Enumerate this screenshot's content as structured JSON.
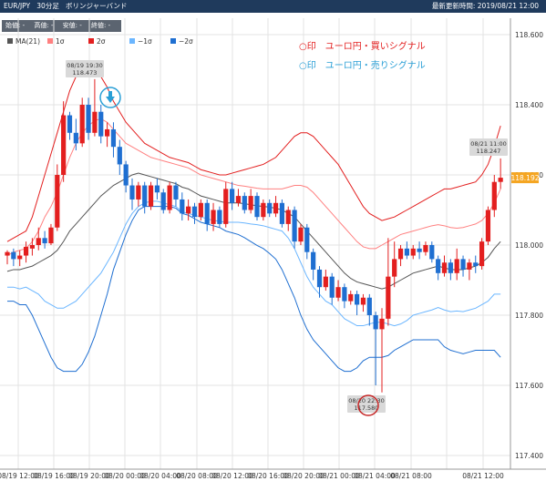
{
  "header": {
    "symbol": "EUR/JPY",
    "interval": "30分足",
    "indicator": "ボリンジャーバンド",
    "updated": "最新更新時間: 2019/08/21 12:00"
  },
  "ohlc": {
    "open": "始値: -",
    "high": "高値: -",
    "low": "安値: -",
    "close": "終値: -"
  },
  "legend": {
    "items": [
      {
        "label": "MA(21)",
        "color": "#555555"
      },
      {
        "label": "1σ",
        "color": "#ff8080"
      },
      {
        "label": "2σ",
        "color": "#e31f1f"
      },
      {
        "label": "−1σ",
        "color": "#6bb6ff"
      },
      {
        "label": "−2σ",
        "color": "#1f6fd1"
      }
    ]
  },
  "annotation": {
    "buy": "○印　ユーロ円・買いシグナル",
    "sell": "○印　ユーロ円・売りシグナル",
    "buy_color": "#e31f1f",
    "sell_color": "#2a9fd6"
  },
  "chart_data": {
    "type": "candlestick",
    "title": "EUR/JPY 30分足 ボリンジャーバンド",
    "ylim": [
      117.4,
      118.64
    ],
    "y_ticks": [
      "117.400",
      "117.600",
      "117.800",
      "118.000",
      "118.200",
      "118.400",
      "118.600"
    ],
    "x_ticks": [
      "08/19 12:00",
      "08/19 16:00",
      "08/19 20:00",
      "08/20 00:00",
      "08/20 04:00",
      "08/20 08:00",
      "08/20 12:00",
      "08/20 16:00",
      "08/20 20:00",
      "08/21 00:00",
      "08/21 04:00",
      "08/21 08:00",
      "08/21 12:00"
    ],
    "up_color": "#e31f1f",
    "down_color": "#1f6fd1",
    "last_price": "118.192",
    "callouts": [
      {
        "label": "08/19 19:30\n118.473",
        "x": "08/19 19:30",
        "y": 118.473
      },
      {
        "label": "08/21 11:00\n118.247",
        "x": "08/21 11:00",
        "y": 118.247
      },
      {
        "label": "08/20 22:30\n117.580",
        "x": "08/20 22:30",
        "y": 117.58
      }
    ],
    "signals": [
      {
        "type": "sell",
        "x": "08/19 19:30",
        "y": 118.473
      },
      {
        "type": "buy",
        "x": "08/20 22:30",
        "y": 117.58
      }
    ],
    "candles": [
      [
        117.97,
        117.98,
        117.945,
        117.985
      ],
      [
        117.98,
        117.96,
        117.94,
        117.99
      ],
      [
        117.96,
        117.97,
        117.94,
        117.985
      ],
      [
        117.97,
        117.995,
        117.95,
        118.01
      ],
      [
        117.99,
        118.0,
        117.97,
        118.02
      ],
      [
        118.0,
        118.02,
        117.985,
        118.05
      ],
      [
        118.02,
        118.005,
        117.99,
        118.04
      ],
      [
        118.005,
        118.05,
        118.0,
        118.06
      ],
      [
        118.05,
        118.2,
        118.04,
        118.23
      ],
      [
        118.2,
        118.37,
        118.18,
        118.41
      ],
      [
        118.37,
        118.32,
        118.3,
        118.38
      ],
      [
        118.32,
        118.29,
        118.27,
        118.36
      ],
      [
        118.29,
        118.4,
        118.28,
        118.42
      ],
      [
        118.4,
        118.32,
        118.3,
        118.42
      ],
      [
        118.32,
        118.38,
        118.31,
        118.473
      ],
      [
        118.38,
        118.31,
        118.29,
        118.4
      ],
      [
        118.31,
        118.33,
        118.28,
        118.35
      ],
      [
        118.33,
        118.28,
        118.25,
        118.35
      ],
      [
        118.28,
        118.23,
        118.2,
        118.3
      ],
      [
        118.23,
        118.17,
        118.15,
        118.24
      ],
      [
        118.17,
        118.13,
        118.1,
        118.19
      ],
      [
        118.13,
        118.17,
        118.11,
        118.18
      ],
      [
        118.17,
        118.11,
        118.09,
        118.18
      ],
      [
        118.11,
        118.17,
        118.1,
        118.18
      ],
      [
        118.17,
        118.15,
        118.13,
        118.19
      ],
      [
        118.15,
        118.1,
        118.09,
        118.16
      ],
      [
        118.1,
        118.17,
        118.09,
        118.18
      ],
      [
        118.17,
        118.13,
        118.11,
        118.18
      ],
      [
        118.13,
        118.09,
        118.07,
        118.15
      ],
      [
        118.09,
        118.11,
        118.07,
        118.13
      ],
      [
        118.11,
        118.08,
        118.06,
        118.12
      ],
      [
        118.08,
        118.12,
        118.07,
        118.13
      ],
      [
        118.12,
        118.06,
        118.04,
        118.13
      ],
      [
        118.06,
        118.1,
        118.04,
        118.12
      ],
      [
        118.1,
        118.06,
        118.05,
        118.11
      ],
      [
        118.06,
        118.16,
        118.05,
        118.18
      ],
      [
        118.16,
        118.12,
        118.1,
        118.18
      ],
      [
        118.12,
        118.14,
        118.11,
        118.16
      ],
      [
        118.14,
        118.1,
        118.09,
        118.15
      ],
      [
        118.1,
        118.14,
        118.09,
        118.16
      ],
      [
        118.14,
        118.08,
        118.07,
        118.15
      ],
      [
        118.08,
        118.12,
        118.07,
        118.13
      ],
      [
        118.12,
        118.09,
        118.08,
        118.13
      ],
      [
        118.09,
        118.12,
        118.08,
        118.14
      ],
      [
        118.12,
        118.06,
        118.05,
        118.13
      ],
      [
        118.06,
        118.1,
        118.04,
        118.11
      ],
      [
        118.1,
        118.01,
        117.99,
        118.11
      ],
      [
        118.01,
        118.05,
        118.0,
        118.06
      ],
      [
        118.05,
        117.98,
        117.96,
        118.06
      ],
      [
        117.98,
        117.93,
        117.9,
        117.99
      ],
      [
        117.93,
        117.88,
        117.85,
        117.94
      ],
      [
        117.88,
        117.91,
        117.87,
        117.93
      ],
      [
        117.91,
        117.85,
        117.83,
        117.92
      ],
      [
        117.85,
        117.88,
        117.84,
        117.9
      ],
      [
        117.88,
        117.84,
        117.82,
        117.89
      ],
      [
        117.84,
        117.86,
        117.83,
        117.87
      ],
      [
        117.86,
        117.83,
        117.8,
        117.87
      ],
      [
        117.83,
        117.85,
        117.81,
        117.86
      ],
      [
        117.85,
        117.8,
        117.77,
        117.86
      ],
      [
        117.8,
        117.76,
        117.6,
        117.81
      ],
      [
        117.76,
        117.79,
        117.58,
        117.82
      ],
      [
        117.79,
        117.91,
        117.77,
        118.02
      ],
      [
        117.91,
        117.96,
        117.88,
        118.01
      ],
      [
        117.96,
        117.99,
        117.94,
        118.0
      ],
      [
        117.99,
        117.97,
        117.96,
        118.01
      ],
      [
        117.97,
        117.99,
        117.96,
        118.0
      ],
      [
        117.99,
        117.98,
        117.96,
        118.01
      ],
      [
        117.98,
        118.0,
        117.97,
        118.01
      ],
      [
        118.0,
        117.96,
        117.95,
        118.01
      ],
      [
        117.96,
        117.92,
        117.9,
        117.97
      ],
      [
        117.92,
        117.95,
        117.91,
        117.97
      ],
      [
        117.95,
        117.92,
        117.9,
        117.96
      ],
      [
        117.92,
        117.96,
        117.9,
        117.99
      ],
      [
        117.96,
        117.93,
        117.91,
        117.97
      ],
      [
        117.93,
        117.95,
        117.9,
        117.96
      ],
      [
        117.95,
        117.94,
        117.92,
        117.97
      ],
      [
        117.94,
        118.01,
        117.93,
        118.02
      ],
      [
        118.01,
        118.1,
        118.0,
        118.11
      ],
      [
        118.1,
        118.18,
        118.08,
        118.2
      ],
      [
        118.18,
        118.192,
        118.16,
        118.247
      ]
    ],
    "bands": {
      "ma21": [
        117.925,
        117.93,
        117.93,
        117.935,
        117.94,
        117.95,
        117.96,
        117.97,
        117.985,
        118.01,
        118.04,
        118.06,
        118.08,
        118.1,
        118.12,
        118.14,
        118.155,
        118.17,
        118.18,
        118.19,
        118.2,
        118.205,
        118.2,
        118.195,
        118.19,
        118.185,
        118.18,
        118.175,
        118.165,
        118.16,
        118.15,
        118.14,
        118.135,
        118.13,
        118.125,
        118.12,
        118.12,
        118.12,
        118.118,
        118.115,
        118.112,
        118.11,
        118.108,
        118.105,
        118.1,
        118.09,
        118.08,
        118.06,
        118.04,
        118.02,
        118.0,
        117.98,
        117.96,
        117.94,
        117.92,
        117.905,
        117.895,
        117.89,
        117.885,
        117.88,
        117.875,
        117.88,
        117.89,
        117.9,
        117.91,
        117.92,
        117.925,
        117.93,
        117.935,
        117.94,
        117.935,
        117.93,
        117.93,
        117.93,
        117.935,
        117.94,
        117.95,
        117.965,
        117.99,
        118.01
      ],
      "up1": [
        117.97,
        117.98,
        117.985,
        117.99,
        118.01,
        118.04,
        118.08,
        118.11,
        118.15,
        118.2,
        118.25,
        118.29,
        118.32,
        118.34,
        118.355,
        118.36,
        118.35,
        118.33,
        118.31,
        118.29,
        118.28,
        118.27,
        118.26,
        118.25,
        118.245,
        118.24,
        118.235,
        118.23,
        118.225,
        118.22,
        118.21,
        118.2,
        118.195,
        118.19,
        118.185,
        118.18,
        118.175,
        118.17,
        118.168,
        118.165,
        118.162,
        118.16,
        118.16,
        118.16,
        118.16,
        118.165,
        118.17,
        118.17,
        118.165,
        118.15,
        118.13,
        118.11,
        118.09,
        118.07,
        118.05,
        118.03,
        118.01,
        117.995,
        117.99,
        117.99,
        118.0,
        118.01,
        118.02,
        118.03,
        118.035,
        118.04,
        118.045,
        118.05,
        118.055,
        118.058,
        118.055,
        118.05,
        118.048,
        118.05,
        118.055,
        118.06,
        118.07,
        118.09,
        118.12,
        118.16
      ],
      "up2": [
        118.01,
        118.02,
        118.03,
        118.04,
        118.08,
        118.14,
        118.2,
        118.26,
        118.32,
        118.38,
        118.44,
        118.48,
        118.5,
        118.505,
        118.5,
        118.48,
        118.45,
        118.41,
        118.38,
        118.35,
        118.33,
        118.31,
        118.29,
        118.28,
        118.27,
        118.26,
        118.25,
        118.245,
        118.24,
        118.235,
        118.225,
        118.215,
        118.21,
        118.205,
        118.2,
        118.2,
        118.205,
        118.21,
        118.215,
        118.22,
        118.225,
        118.23,
        118.24,
        118.25,
        118.27,
        118.29,
        118.31,
        118.32,
        118.32,
        118.31,
        118.29,
        118.27,
        118.25,
        118.23,
        118.2,
        118.17,
        118.14,
        118.11,
        118.09,
        118.08,
        118.07,
        118.075,
        118.08,
        118.09,
        118.1,
        118.11,
        118.12,
        118.13,
        118.14,
        118.15,
        118.16,
        118.16,
        118.165,
        118.17,
        118.175,
        118.18,
        118.2,
        118.23,
        118.28,
        118.34
      ],
      "dn1": [
        117.88,
        117.88,
        117.875,
        117.88,
        117.87,
        117.86,
        117.84,
        117.83,
        117.82,
        117.82,
        117.83,
        117.84,
        117.86,
        117.88,
        117.9,
        117.92,
        117.95,
        117.98,
        118.02,
        118.06,
        118.09,
        118.11,
        118.12,
        118.125,
        118.125,
        118.12,
        118.115,
        118.11,
        118.095,
        118.09,
        118.085,
        118.08,
        118.075,
        118.07,
        118.068,
        118.065,
        118.065,
        118.065,
        118.063,
        118.06,
        118.058,
        118.055,
        118.05,
        118.045,
        118.04,
        118.02,
        117.99,
        117.95,
        117.91,
        117.88,
        117.86,
        117.84,
        117.83,
        117.81,
        117.79,
        117.78,
        117.77,
        117.77,
        117.775,
        117.78,
        117.78,
        117.775,
        117.77,
        117.775,
        117.785,
        117.8,
        117.805,
        117.81,
        117.815,
        117.822,
        117.815,
        117.81,
        117.812,
        117.81,
        117.815,
        117.82,
        117.83,
        117.84,
        117.86,
        117.86
      ],
      "dn2": [
        117.84,
        117.84,
        117.83,
        117.83,
        117.8,
        117.76,
        117.72,
        117.68,
        117.65,
        117.64,
        117.64,
        117.64,
        117.66,
        117.695,
        117.74,
        117.8,
        117.86,
        117.93,
        117.98,
        118.03,
        118.07,
        118.1,
        118.11,
        118.11,
        118.11,
        118.11,
        118.11,
        118.105,
        118.09,
        118.085,
        118.075,
        118.065,
        118.06,
        118.055,
        118.05,
        118.04,
        118.035,
        118.03,
        118.021,
        118.01,
        117.999,
        117.99,
        117.976,
        117.96,
        117.93,
        117.89,
        117.85,
        117.8,
        117.76,
        117.73,
        117.71,
        117.69,
        117.67,
        117.65,
        117.64,
        117.64,
        117.65,
        117.67,
        117.68,
        117.68,
        117.68,
        117.685,
        117.7,
        117.71,
        117.72,
        117.73,
        117.73,
        117.73,
        117.73,
        117.73,
        117.71,
        117.7,
        117.695,
        117.69,
        117.695,
        117.7,
        117.7,
        117.7,
        117.7,
        117.68
      ]
    }
  }
}
